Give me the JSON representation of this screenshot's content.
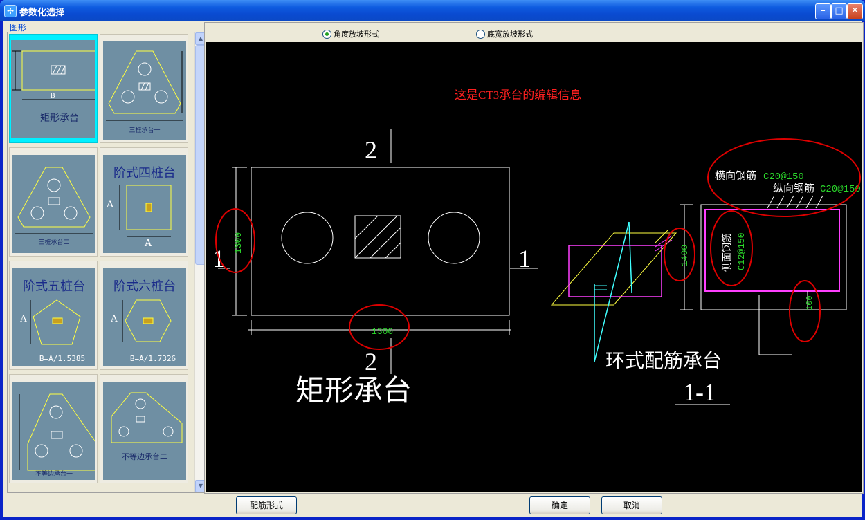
{
  "window": {
    "title": "参数化选择",
    "icon": "app-icon"
  },
  "left": {
    "group_label": "图形",
    "thumbnails": [
      {
        "caption": "矩形承台",
        "dim_b": "B",
        "selected": true
      },
      {
        "caption": "三桩承台一"
      },
      {
        "caption": "三桩承台二"
      },
      {
        "caption": "阶式四桩台",
        "dim_a1": "A",
        "dim_a2": "A"
      },
      {
        "caption": "阶式五桩台",
        "dim_a": "A",
        "formula": "B=A/1.5385"
      },
      {
        "caption": "阶式六桩台",
        "dim_a": "A",
        "formula": "B=A/1.7326"
      },
      {
        "caption": "不等边承台一"
      },
      {
        "caption": "不等边承台二"
      }
    ]
  },
  "options": {
    "radio1": {
      "label": "角度放坡形式",
      "checked": true
    },
    "radio2": {
      "label": "底宽放坡形式",
      "checked": false
    }
  },
  "drawing": {
    "info": "这是CT3承台的编辑信息",
    "rect": {
      "cut_top": "2",
      "cut_bottom": "2",
      "cut_left": "1",
      "cut_right": "1",
      "dim_height": "1300",
      "dim_width": "1300",
      "title": "矩形承台"
    },
    "section": {
      "transverse_label": "横向钢筋",
      "transverse_value": "C20@150",
      "longitudinal_label": "纵向钢筋",
      "longitudinal_value": "C20@150",
      "side_label": "侧面钢筋",
      "side_value": "C12@150",
      "dim_height": "1400",
      "dim_cover": "100",
      "ring_title": "环式配筋承台",
      "section_label": "1-1"
    }
  },
  "buttons": {
    "rebar_form": "配筋形式",
    "ok": "确定",
    "cancel": "取消"
  },
  "colors": {
    "cad_white": "#FFFFFF",
    "cad_green": "#2BD92B",
    "cad_red": "#FF2020",
    "cad_magenta": "#FF40FF",
    "cad_yellow": "#FFFF40",
    "cad_cyan": "#40FFFF",
    "highlight": "#DD0000"
  }
}
